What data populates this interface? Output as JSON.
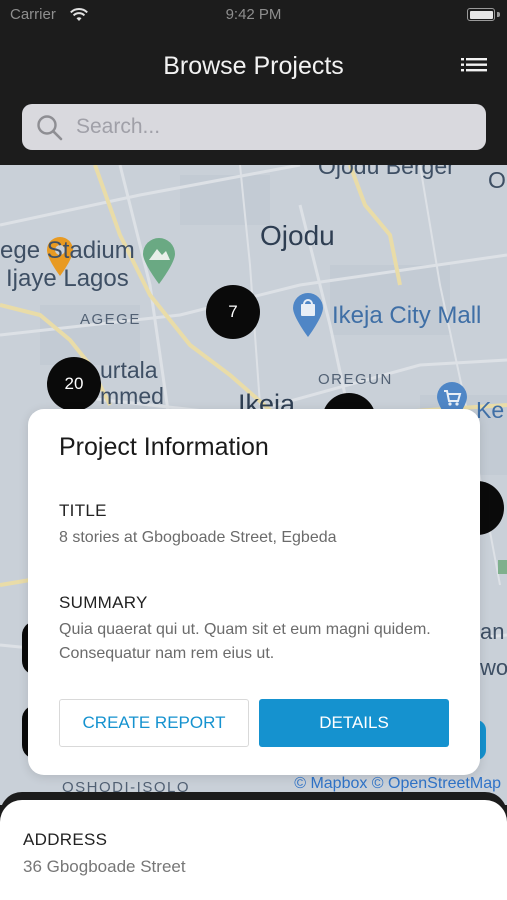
{
  "status_bar": {
    "carrier": "Carrier",
    "time": "9:42 PM"
  },
  "header": {
    "title": "Browse Projects",
    "menu_icon": "list-icon"
  },
  "search": {
    "placeholder": "Search..."
  },
  "map": {
    "labels": {
      "ojodu_berger": "Ojodu Berger",
      "ojodu": "Ojodu",
      "stadium_1": "ege Stadium",
      "stadium_2": "Ijaye Lagos",
      "agege": "AGEGE",
      "ikeja_mall": "Ikeja City Mall",
      "oregun": "OREGUN",
      "murtala_1": "urtala",
      "murtala_2": "mmed",
      "ikeja": "Ikeja",
      "ke": "Ke",
      "o_right": "O",
      "an": "an",
      "wo": "wo",
      "oshodi": "OSHODI-ISOLO"
    },
    "clusters": {
      "seven": "7",
      "twenty": "20"
    },
    "attribution": "© Mapbox © OpenStreetMap"
  },
  "card": {
    "title": "Project Information",
    "title_label": "TITLE",
    "title_value": "8 stories at Gbogboade Street, Egbeda",
    "summary_label": "SUMMARY",
    "summary_value": "Quia quaerat qui ut. Quam sit et eum magni quidem. Consequatur nam rem eius ut.",
    "create_report": "CREATE REPORT",
    "details": "DETAILS"
  },
  "sheet": {
    "address_label": "ADDRESS",
    "address_value": "36 Gbogboade Street"
  },
  "colors": {
    "accent": "#1592cf",
    "header_bg": "#1c1c1c",
    "map_bg": "#c9d0d8"
  }
}
